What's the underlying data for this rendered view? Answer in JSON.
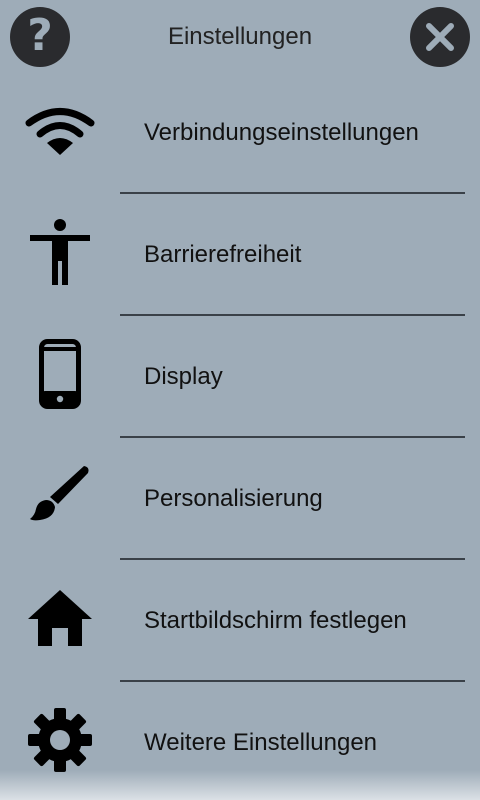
{
  "header": {
    "title": "Einstellungen",
    "help_icon": "question-mark-icon",
    "close_icon": "close-icon"
  },
  "menu": {
    "items": [
      {
        "label": "Verbindungseinstellungen",
        "icon": "wifi-icon"
      },
      {
        "label": "Barrierefreiheit",
        "icon": "accessibility-icon"
      },
      {
        "label": "Display",
        "icon": "smartphone-icon"
      },
      {
        "label": "Personalisierung",
        "icon": "paintbrush-icon"
      },
      {
        "label": "Startbildschirm festlegen",
        "icon": "home-icon"
      },
      {
        "label": "Weitere Einstellungen",
        "icon": "gear-icon"
      }
    ]
  },
  "colors": {
    "background": "#9eacb8",
    "button": "#2a2b2e",
    "divider": "#3a4148",
    "text": "#111111"
  }
}
